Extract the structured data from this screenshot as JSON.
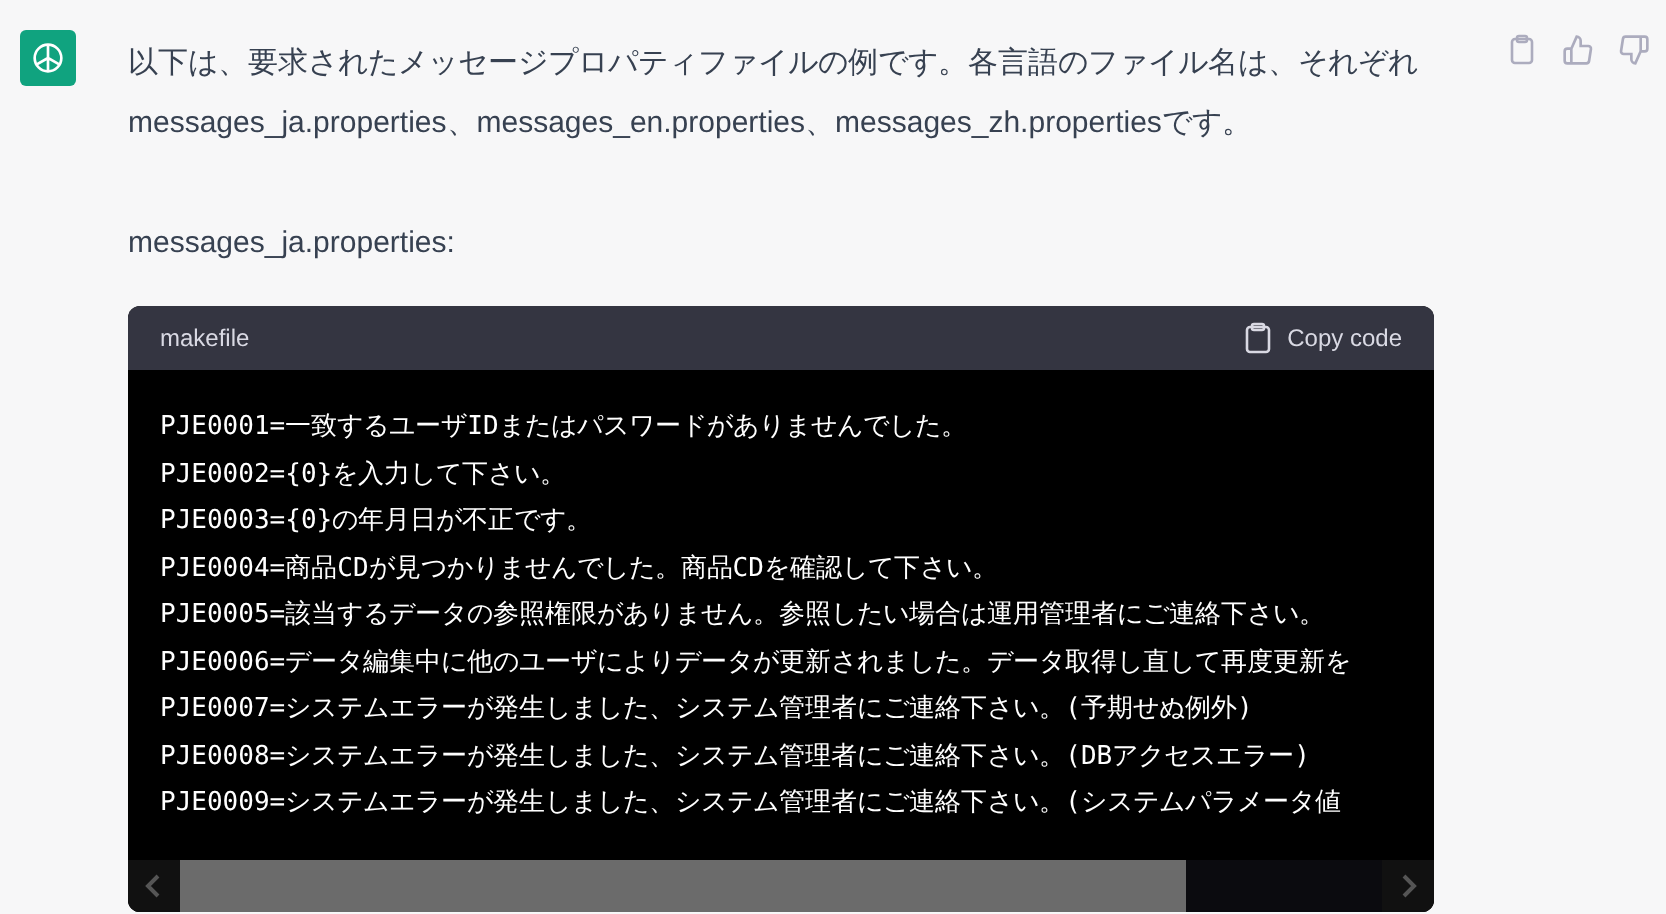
{
  "message": {
    "paragraphs": [
      "以下は、要求されたメッセージプロパティファイルの例です。各言語のファイル名は、それぞれ messages_ja.properties、messages_en.properties、messages_zh.propertiesです。",
      "messages_ja.properties:"
    ],
    "code_block": {
      "language": "makefile",
      "copy_label": "Copy code",
      "lines": [
        "PJE0001=一致するユーザIDまたはパスワードがありませんでした。",
        "PJE0002={0}を入力して下さい。",
        "PJE0003={0}の年月日が不正です。",
        "PJE0004=商品CDが見つかりませんでした。商品CDを確認して下さい。",
        "PJE0005=該当するデータの参照権限がありません。参照したい場合は運用管理者にご連絡下さい。",
        "PJE0006=データ編集中に他のユーザによりデータが更新されました。データ取得し直して再度更新を",
        "PJE0007=システムエラーが発生しました、システム管理者にご連絡下さい。(予期せぬ例外)",
        "PJE0008=システムエラーが発生しました、システム管理者にご連絡下さい。(DBアクセスエラー)",
        "PJE0009=システムエラーが発生しました、システム管理者にご連絡下さい。(システムパラメータ値"
      ]
    }
  }
}
